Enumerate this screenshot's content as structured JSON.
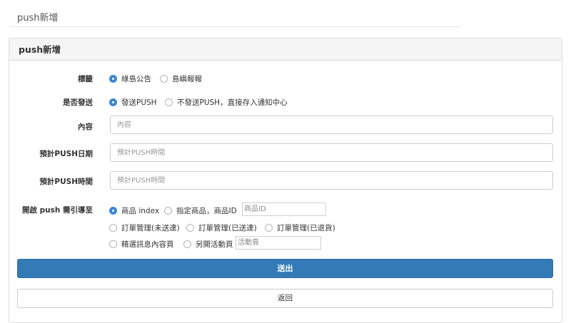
{
  "page_header": "push新增",
  "panel_title": "push新增",
  "form": {
    "tag": {
      "label": "標籤",
      "options": [
        "綠島公告",
        "島嶼報報"
      ],
      "selected": 0
    },
    "send": {
      "label": "是否發送",
      "options": [
        "發送PUSH",
        "不發送PUSH，直接存入通知中心"
      ],
      "selected": 0
    },
    "content": {
      "label": "內容",
      "placeholder": "內容"
    },
    "date": {
      "label": "預計PUSH日期",
      "placeholder": "預計PUSH時間"
    },
    "time": {
      "label": "預計PUSH時間",
      "placeholder": "預計PUSH時間"
    },
    "target": {
      "label": "開啟 push 需引導至",
      "options": [
        "商品 index",
        "指定商品，商品ID",
        "訂單管理(未送達)",
        "訂單管理(已送達)",
        "訂單管理(已退貨)",
        "精選訊息內容頁",
        "另開活動頁"
      ],
      "selected": 0,
      "product_id_placeholder": "商品ID",
      "activity_placeholder": "活動頁"
    }
  },
  "buttons": {
    "submit": "送出",
    "back": "返回"
  },
  "colors": {
    "primary": "#337ab7",
    "radio_on": "#3b86d6",
    "panel_heading": "#f5f5f5"
  }
}
